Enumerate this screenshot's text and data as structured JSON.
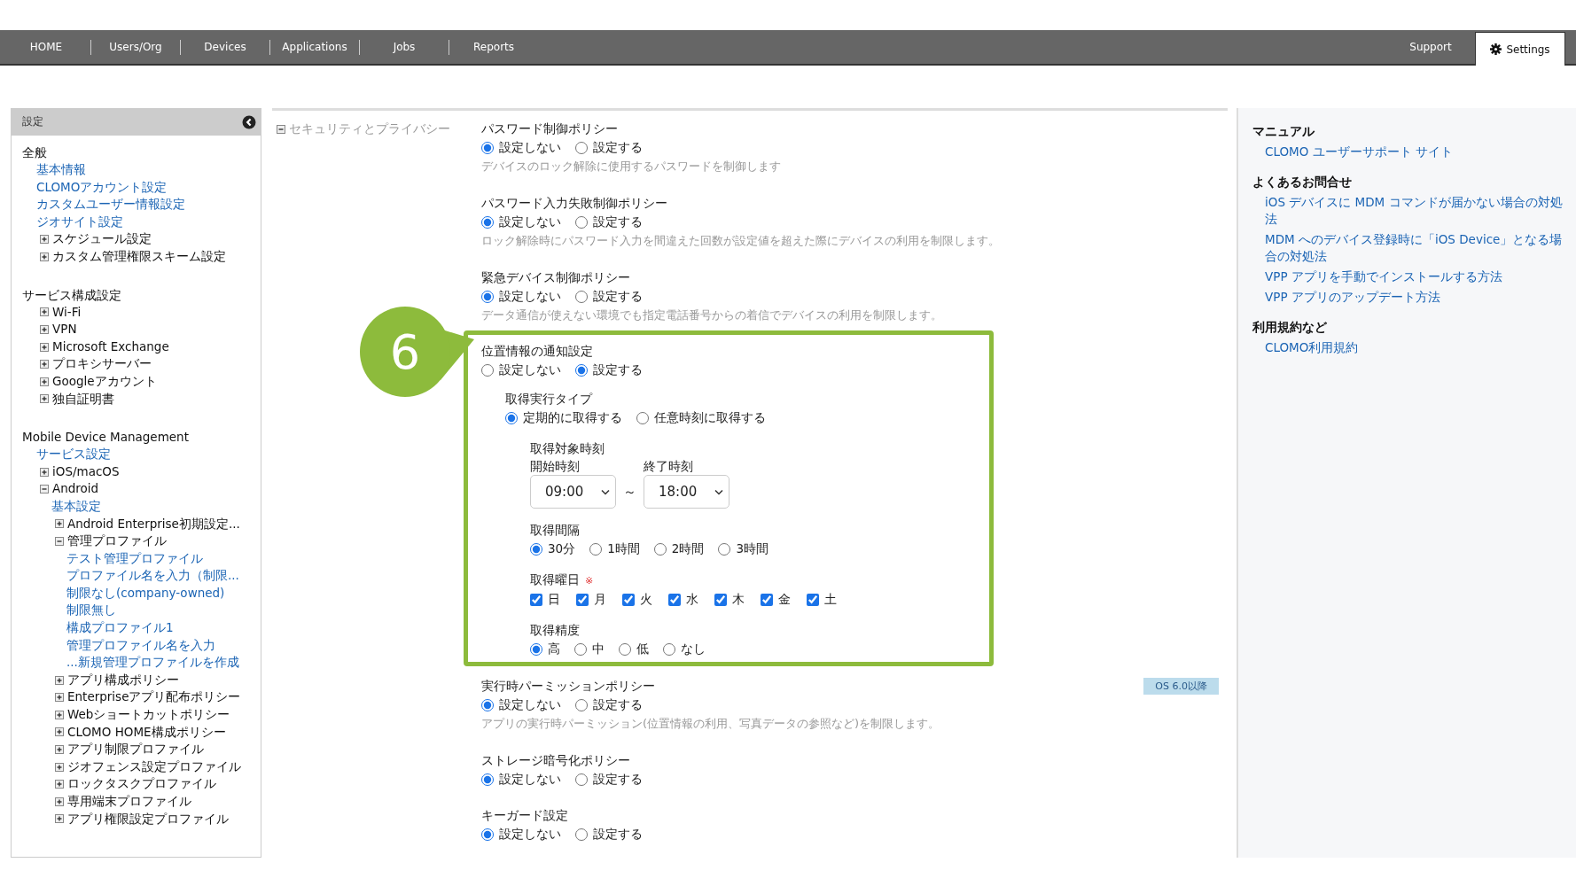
{
  "nav": {
    "left": [
      {
        "label": "HOME",
        "selected": false
      },
      {
        "label": "Users/Org",
        "selected": false
      },
      {
        "label": "Devices",
        "selected": false
      },
      {
        "label": "Applications",
        "selected": false
      },
      {
        "label": "Jobs",
        "selected": false
      },
      {
        "label": "Reports",
        "selected": false
      }
    ],
    "right": [
      {
        "label": "Support",
        "selected": false
      },
      {
        "label": "Settings",
        "selected": true
      }
    ]
  },
  "sidebar": {
    "title": "設定",
    "sections": [
      {
        "heading": "全般",
        "items": [
          {
            "label": "基本情報",
            "kind": "link"
          },
          {
            "label": "CLOMOアカウント設定",
            "kind": "link"
          },
          {
            "label": "カスタムユーザー情報設定",
            "kind": "link"
          },
          {
            "label": "ジオサイト設定",
            "kind": "link"
          },
          {
            "label": "スケジュール設定",
            "kind": "folder",
            "expanded": false
          },
          {
            "label": "カスタム管理権限スキーム設定",
            "kind": "folder",
            "expanded": false
          }
        ]
      },
      {
        "heading": "サービス構成設定",
        "items": [
          {
            "label": "Wi-Fi",
            "kind": "folder",
            "expanded": false
          },
          {
            "label": "VPN",
            "kind": "folder",
            "expanded": false
          },
          {
            "label": "Microsoft Exchange",
            "kind": "folder",
            "expanded": false
          },
          {
            "label": "プロキシサーバー",
            "kind": "folder",
            "expanded": false
          },
          {
            "label": "Googleアカウント",
            "kind": "folder",
            "expanded": false
          },
          {
            "label": "独自証明書",
            "kind": "folder",
            "expanded": false
          }
        ]
      },
      {
        "heading": "Mobile Device Management",
        "items": [
          {
            "label": "サービス設定",
            "kind": "link"
          },
          {
            "label": "iOS/macOS",
            "kind": "folder",
            "expanded": false
          },
          {
            "label": "Android",
            "kind": "folder",
            "expanded": true,
            "children": [
              {
                "label": "基本設定",
                "kind": "link"
              },
              {
                "label": "Android Enterprise初期設定...",
                "kind": "folder",
                "expanded": false
              },
              {
                "label": "管理プロファイル",
                "kind": "folder",
                "expanded": true,
                "children": [
                  {
                    "label": "テスト管理プロファイル",
                    "kind": "link"
                  },
                  {
                    "label": "プロファイル名を入力（制限...",
                    "kind": "link"
                  },
                  {
                    "label": "制限なし(company-owned)",
                    "kind": "link"
                  },
                  {
                    "label": "制限無し",
                    "kind": "link"
                  },
                  {
                    "label": "構成プロファイル1",
                    "kind": "link"
                  },
                  {
                    "label": "管理プロファイル名を入力",
                    "kind": "link"
                  },
                  {
                    "label": "...新規管理プロファイルを作成",
                    "kind": "link"
                  }
                ]
              },
              {
                "label": "アプリ構成ポリシー",
                "kind": "folder",
                "expanded": false
              },
              {
                "label": "Enterpriseアプリ配布ポリシー",
                "kind": "folder",
                "expanded": false
              },
              {
                "label": "Webショートカットポリシー",
                "kind": "folder",
                "expanded": false
              },
              {
                "label": "CLOMO HOME構成ポリシー",
                "kind": "folder",
                "expanded": false
              },
              {
                "label": "アプリ制限プロファイル",
                "kind": "folder",
                "expanded": false
              },
              {
                "label": "ジオフェンス設定プロファイル",
                "kind": "folder",
                "expanded": false
              },
              {
                "label": "ロックタスクプロファイル",
                "kind": "folder",
                "expanded": false
              },
              {
                "label": "専用端末プロファイル",
                "kind": "folder",
                "expanded": false
              },
              {
                "label": "アプリ権限設定プロファイル",
                "kind": "folder",
                "expanded": false
              }
            ]
          }
        ]
      }
    ]
  },
  "main": {
    "section": {
      "label": "セキュリティとプライバシー",
      "expanded": true
    },
    "policies": [
      {
        "title": "パスワード制御ポリシー",
        "options": [
          {
            "label": "設定しない",
            "selected": true
          },
          {
            "label": "設定する",
            "selected": false
          }
        ],
        "description": "デバイスのロック解除に使用するパスワードを制御します"
      },
      {
        "title": "パスワード入力失敗制御ポリシー",
        "options": [
          {
            "label": "設定しない",
            "selected": true
          },
          {
            "label": "設定する",
            "selected": false
          }
        ],
        "description": "ロック解除時にパスワード入力を間違えた回数が設定値を超えた際にデバイスの利用を制限します。"
      },
      {
        "title": "緊急デバイス制御ポリシー",
        "options": [
          {
            "label": "設定しない",
            "selected": true
          },
          {
            "label": "設定する",
            "selected": false
          }
        ],
        "description": "データ通信が使えない環境でも指定電話番号からの着信でデバイスの利用を制限します。"
      },
      {
        "title": "位置情報の通知設定",
        "callout": "6",
        "options": [
          {
            "label": "設定しない",
            "selected": false
          },
          {
            "label": "設定する",
            "selected": true
          }
        ],
        "settings": [
          {
            "kind": "radio",
            "label": "取得実行タイプ",
            "options": [
              {
                "label": "定期的に取得する",
                "selected": true
              },
              {
                "label": "任意時刻に取得する",
                "selected": false
              }
            ],
            "children": [
              {
                "kind": "time_range",
                "label": "取得対象時刻",
                "start": {
                  "label": "開始時刻",
                  "value": "09:00"
                },
                "separator": "～",
                "end": {
                  "label": "終了時刻",
                  "value": "18:00"
                }
              },
              {
                "kind": "radio",
                "label": "取得間隔",
                "options": [
                  {
                    "label": "30分",
                    "selected": true
                  },
                  {
                    "label": "1時間",
                    "selected": false
                  },
                  {
                    "label": "2時間",
                    "selected": false
                  },
                  {
                    "label": "3時間",
                    "selected": false
                  }
                ]
              },
              {
                "kind": "checkboxes",
                "label": "取得曜日",
                "required_mark": "※",
                "options": [
                  {
                    "label": "日",
                    "checked": true
                  },
                  {
                    "label": "月",
                    "checked": true
                  },
                  {
                    "label": "火",
                    "checked": true
                  },
                  {
                    "label": "水",
                    "checked": true
                  },
                  {
                    "label": "木",
                    "checked": true
                  },
                  {
                    "label": "金",
                    "checked": true
                  },
                  {
                    "label": "土",
                    "checked": true
                  }
                ]
              },
              {
                "kind": "radio",
                "label": "取得精度",
                "options": [
                  {
                    "label": "高",
                    "selected": true
                  },
                  {
                    "label": "中",
                    "selected": false
                  },
                  {
                    "label": "低",
                    "selected": false
                  },
                  {
                    "label": "なし",
                    "selected": false
                  }
                ]
              }
            ]
          }
        ]
      },
      {
        "title": "実行時パーミッションポリシー",
        "badge": "OS 6.0以降",
        "options": [
          {
            "label": "設定しない",
            "selected": true
          },
          {
            "label": "設定する",
            "selected": false
          }
        ],
        "description": "アプリの実行時パーミッション(位置情報の利用、写真データの参照など)を制限します。"
      },
      {
        "title": "ストレージ暗号化ポリシー",
        "options": [
          {
            "label": "設定しない",
            "selected": true
          },
          {
            "label": "設定する",
            "selected": false
          }
        ]
      },
      {
        "title": "キーガード設定",
        "options": [
          {
            "label": "設定しない",
            "selected": true
          },
          {
            "label": "設定する",
            "selected": false
          }
        ]
      }
    ]
  },
  "help": {
    "sections": [
      {
        "heading": "マニュアル",
        "links": [
          "CLOMO ユーザーサポート サイト"
        ]
      },
      {
        "heading": "よくあるお問合せ",
        "links": [
          "iOS デバイスに MDM コマンドが届かない場合の対処法",
          "MDM へのデバイス登録時に「iOS Device」となる場合の対処法",
          "VPP アプリを手動でインストールする方法",
          "VPP アプリのアップデート方法"
        ]
      },
      {
        "heading": "利用規約など",
        "links": [
          "CLOMO利用規約"
        ]
      }
    ]
  }
}
